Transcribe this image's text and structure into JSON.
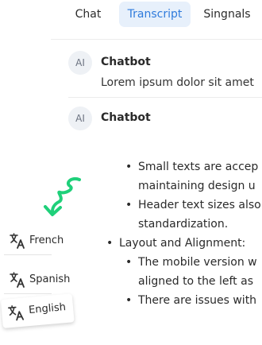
{
  "tabs": [
    {
      "label": "Chat",
      "active": false
    },
    {
      "label": "Transcript",
      "active": true
    },
    {
      "label": "Singnals",
      "active": false
    }
  ],
  "messages": [
    {
      "avatar": "AI",
      "sender": "Chatbot",
      "text": "Lorem ipsum dolor sit amet"
    },
    {
      "avatar": "AI",
      "sender": "Chatbot"
    }
  ],
  "content": {
    "lines": [
      "Small texts are accep",
      "maintaining design u",
      "Header text sizes also",
      "standardization.",
      "Layout and Alignment:",
      "The mobile version w",
      "aligned to the left as",
      "There are issues with"
    ]
  },
  "languages": [
    {
      "label": "French",
      "icon": "translate-icon"
    },
    {
      "label": "Spanish",
      "icon": "translate-icon"
    },
    {
      "label": "English",
      "icon": "translate-icon"
    }
  ],
  "colors": {
    "accent": "#2f7bdc",
    "active_tab_bg": "#e7f0fb",
    "squiggle": "#1fd07a"
  }
}
